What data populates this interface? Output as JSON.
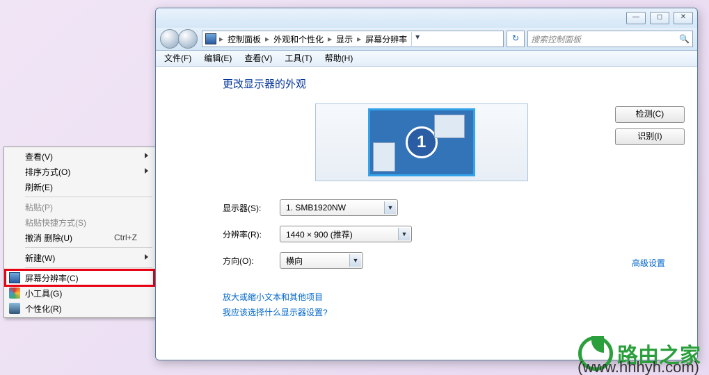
{
  "ctx": {
    "view": "查看(V)",
    "sort": "排序方式(O)",
    "refresh": "刷新(E)",
    "paste": "粘贴(P)",
    "pasteShortcut": "粘贴快捷方式(S)",
    "undo": "撤消 删除(U)",
    "undoKey": "Ctrl+Z",
    "new": "新建(W)",
    "res": "屏幕分辨率(C)",
    "gadget": "小工具(G)",
    "pers": "个性化(R)"
  },
  "win": {
    "min": "—",
    "max": "◻",
    "close": "✕",
    "breadcrumb": [
      "控制面板",
      "外观和个性化",
      "显示",
      "屏幕分辨率"
    ],
    "refreshGlyph": "↻",
    "searchPlaceholder": "搜索控制面板",
    "searchGlyph": "🔍",
    "menus": [
      "文件(F)",
      "编辑(E)",
      "查看(V)",
      "工具(T)",
      "帮助(H)"
    ]
  },
  "page": {
    "title": "更改显示器的外观",
    "monitorNumber": "1",
    "detect": "检测(C)",
    "identify": "识别(I)",
    "displayLabel": "显示器(S):",
    "displayValue": "1. SMB1920NW",
    "resLabel": "分辨率(R):",
    "resValue": "1440 × 900 (推荐)",
    "orientLabel": "方向(O):",
    "orientValue": "横向",
    "advanced": "高级设置",
    "link1": "放大或缩小文本和其他项目",
    "link2": "我应该选择什么显示器设置?"
  },
  "watermark": {
    "brand": "路由之家",
    "url": "(www.hhhyh.com)"
  }
}
